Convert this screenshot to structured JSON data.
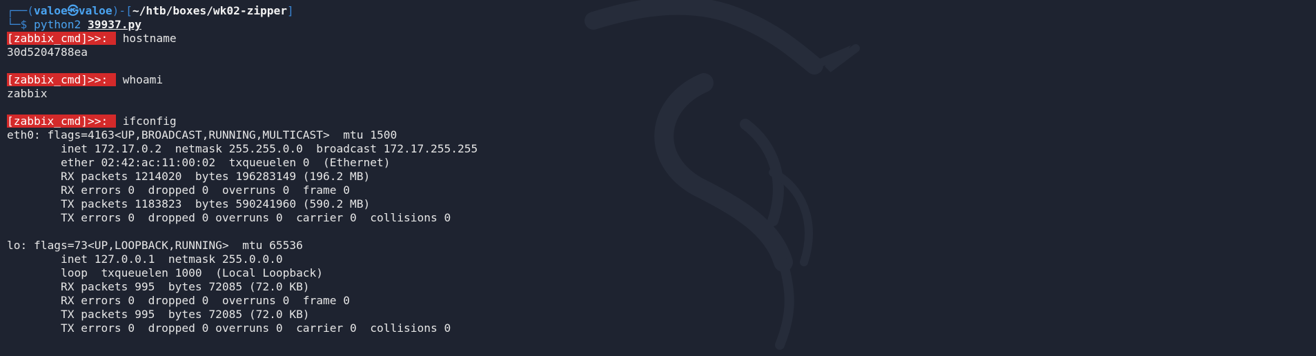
{
  "prompt": {
    "frame_top_left": "┌──(",
    "user": "valoe",
    "skull": "㉿",
    "host": "valoe",
    "frame_mid": ")-[",
    "path": "~/htb/boxes/wk02-zipper",
    "frame_close": "]",
    "frame_bottom": "└─$ ",
    "program": "python2",
    "argument": "39937.py"
  },
  "shell_prompt": "[zabbix_cmd]>>: ",
  "session": [
    {
      "command": "hostname",
      "output": [
        "30d5204788ea"
      ]
    },
    {
      "command": "whoami",
      "output": [
        "zabbix"
      ]
    },
    {
      "command": "ifconfig",
      "output": [
        "eth0: flags=4163<UP,BROADCAST,RUNNING,MULTICAST>  mtu 1500",
        "        inet 172.17.0.2  netmask 255.255.0.0  broadcast 172.17.255.255",
        "        ether 02:42:ac:11:00:02  txqueuelen 0  (Ethernet)",
        "        RX packets 1214020  bytes 196283149 (196.2 MB)",
        "        RX errors 0  dropped 0  overruns 0  frame 0",
        "        TX packets 1183823  bytes 590241960 (590.2 MB)",
        "        TX errors 0  dropped 0 overruns 0  carrier 0  collisions 0",
        "",
        "lo: flags=73<UP,LOOPBACK,RUNNING>  mtu 65536",
        "        inet 127.0.0.1  netmask 255.0.0.0",
        "        loop  txqueuelen 1000  (Local Loopback)",
        "        RX packets 995  bytes 72085 (72.0 KB)",
        "        RX errors 0  dropped 0  overruns 0  frame 0",
        "        TX packets 995  bytes 72085 (72.0 KB)",
        "        TX errors 0  dropped 0 overruns 0  carrier 0  collisions 0"
      ]
    }
  ],
  "colors": {
    "background": "#1e2330",
    "prompt_blue": "#4aa3f0",
    "zabbix_prompt_bg": "#d42a2a",
    "text": "#e6e6e6"
  },
  "background_icon": "kali-dragon-icon"
}
